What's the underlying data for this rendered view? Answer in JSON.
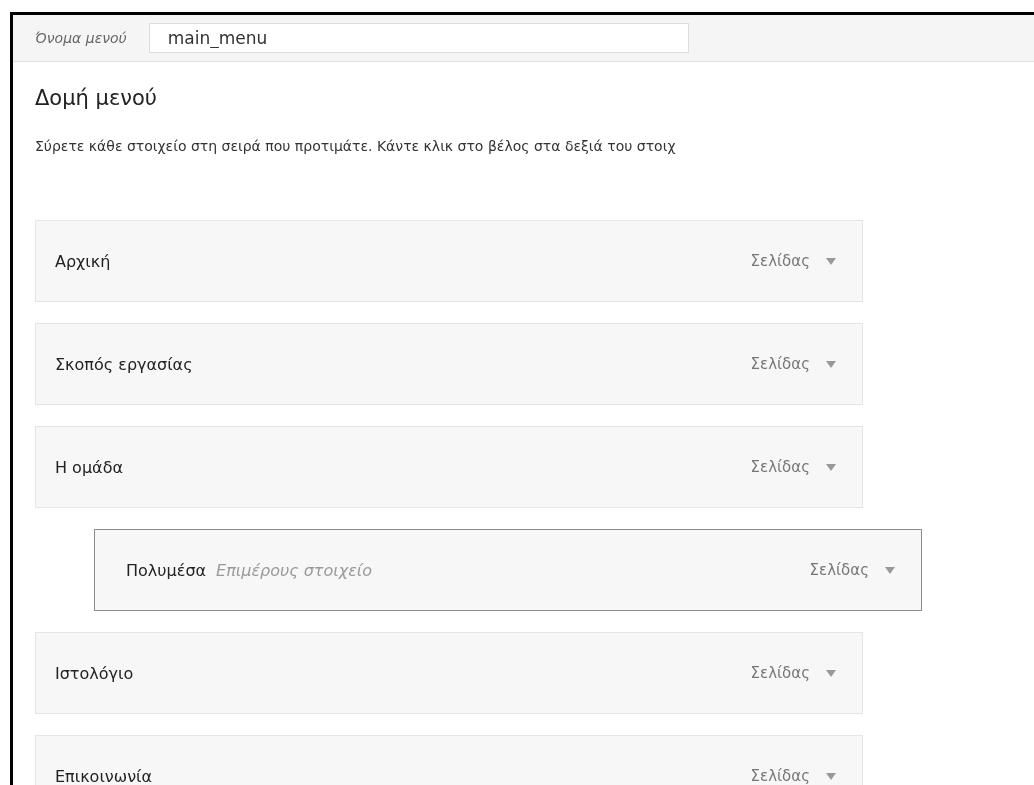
{
  "menu_name": {
    "label": "Όνομα μενού",
    "value": "main_menu"
  },
  "structure": {
    "title": "Δομή μενού",
    "instructions": "Σύρετε κάθε στοιχείο στη σειρά που προτιμάτε. Κάντε κλικ στο βέλος στα δεξιά του στοιχ"
  },
  "items": [
    {
      "label": "Αρχική",
      "type": "Σελίδας"
    },
    {
      "label": "Σκοπός εργασίας",
      "type": "Σελίδας"
    },
    {
      "label": "Η ομάδα",
      "type": "Σελίδας",
      "children": [
        {
          "label": "Πολυμέσα",
          "note": "Επιμέρους στοιχείο",
          "type": "Σελίδας"
        }
      ]
    },
    {
      "label": "Ιστολόγιο",
      "type": "Σελίδας"
    },
    {
      "label": "Επικοινωνία",
      "type": "Σελίδας"
    }
  ]
}
